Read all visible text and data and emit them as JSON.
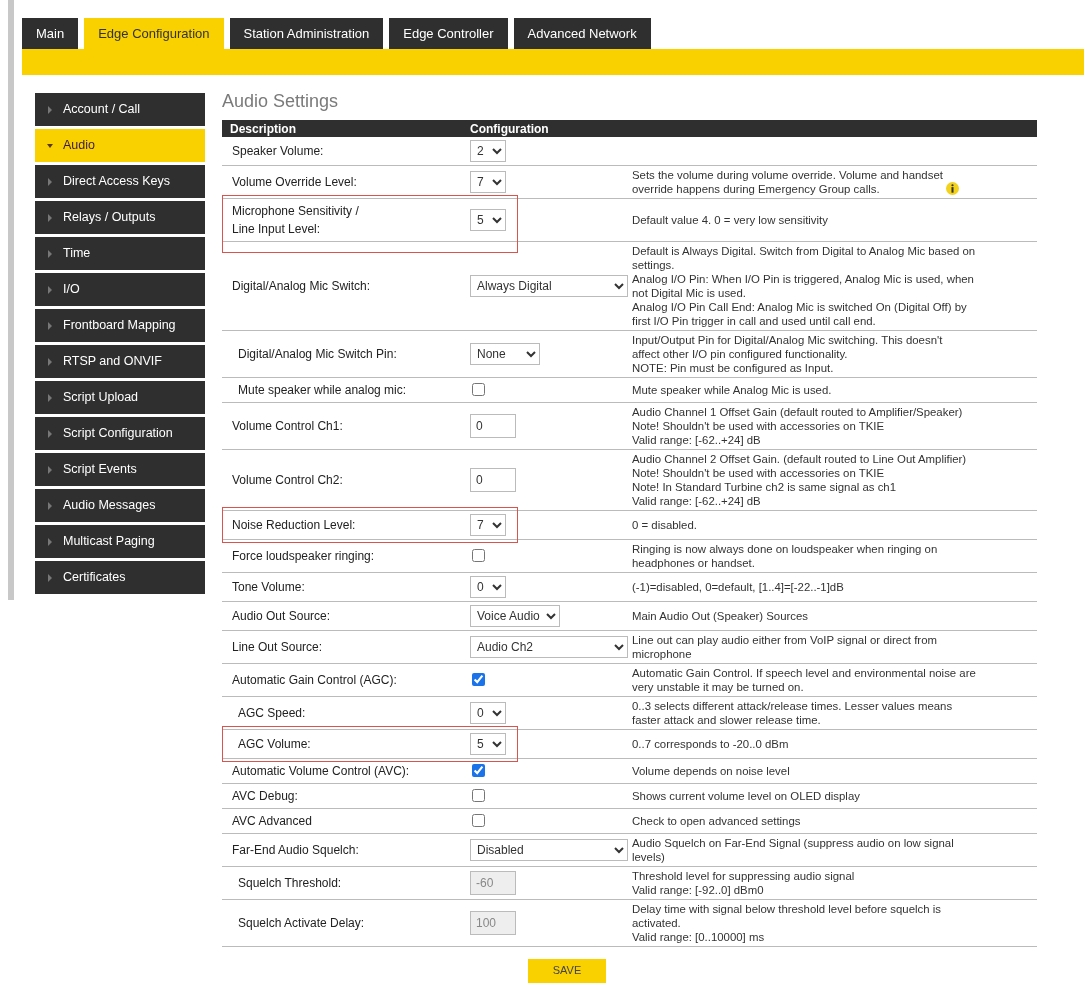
{
  "tabs": [
    {
      "label": "Main",
      "selected": false
    },
    {
      "label": "Edge Configuration",
      "selected": true
    },
    {
      "label": "Station Administration",
      "selected": false
    },
    {
      "label": "Edge Controller",
      "selected": false
    },
    {
      "label": "Advanced Network",
      "selected": false
    }
  ],
  "sidebar": {
    "items": [
      {
        "label": "Account / Call",
        "selected": false
      },
      {
        "label": "Audio",
        "selected": true
      },
      {
        "label": "Direct Access Keys",
        "selected": false
      },
      {
        "label": "Relays / Outputs",
        "selected": false
      },
      {
        "label": "Time",
        "selected": false
      },
      {
        "label": "I/O",
        "selected": false
      },
      {
        "label": "Frontboard Mapping",
        "selected": false
      },
      {
        "label": "RTSP and ONVIF",
        "selected": false
      },
      {
        "label": "Script Upload",
        "selected": false
      },
      {
        "label": "Script Configuration",
        "selected": false
      },
      {
        "label": "Script Events",
        "selected": false
      },
      {
        "label": "Audio Messages",
        "selected": false
      },
      {
        "label": "Multicast Paging",
        "selected": false
      },
      {
        "label": "Certificates",
        "selected": false
      }
    ]
  },
  "page_title": "Audio Settings",
  "table": {
    "columns": [
      "Description",
      "Configuration"
    ],
    "rows": [
      {
        "label": "Speaker Volume:",
        "kind": "level",
        "value": "2",
        "indented": false,
        "highlighted": false
      },
      {
        "label": "Volume Override Level:",
        "kind": "level",
        "value": "7",
        "help": "Sets the volume during volume override. Volume and handset\noverride happens during Emergency Group calls.",
        "info": true,
        "indented": false,
        "highlighted": false
      },
      {
        "label": "Microphone Sensitivity /\nLine Input Level:",
        "kind": "level",
        "value": "5",
        "help": "Default value 4. 0 = very low sensitivity",
        "indented": false,
        "highlighted": true
      },
      {
        "label": "Digital/Analog Mic Switch:",
        "kind": "wideselect",
        "value": "Always Digital",
        "help": "Default is Always Digital. Switch from Digital to Analog Mic based on\nsettings.\nAnalog I/O Pin: When I/O Pin is triggered, Analog Mic is used, when\nnot Digital Mic is used.\nAnalog I/O Pin Call End: Analog Mic is switched On (Digital Off) by\nfirst I/O Pin trigger in call and used until call end.",
        "indented": false,
        "highlighted": false
      },
      {
        "label": "Digital/Analog Mic Switch Pin:",
        "kind": "select",
        "value": "None",
        "help": "Input/Output Pin for Digital/Analog Mic switching. This doesn't\naffect other I/O pin configured functionality.\nNOTE: Pin must be configured as Input.",
        "indented": true,
        "highlighted": false
      },
      {
        "label": "Mute speaker while analog mic:",
        "kind": "checkbox",
        "checked": false,
        "help": "Mute speaker while Analog Mic is used.",
        "indented": true,
        "highlighted": false
      },
      {
        "label": "Volume Control Ch1:",
        "kind": "input",
        "value": "0",
        "disabled": false,
        "help": "Audio Channel 1 Offset Gain (default routed to Amplifier/Speaker)\nNote! Shouldn't be used with accessories on TKIE\nValid range: [-62..+24] dB",
        "indented": false,
        "highlighted": false
      },
      {
        "label": "Volume Control Ch2:",
        "kind": "input",
        "value": "0",
        "disabled": false,
        "help": "Audio Channel 2 Offset Gain. (default routed to Line Out Amplifier)\nNote! Shouldn't be used with accessories on TKIE\nNote! In Standard Turbine ch2 is same signal as ch1\nValid range: [-62..+24] dB",
        "indented": false,
        "highlighted": false
      },
      {
        "label": "Noise Reduction Level:",
        "kind": "level",
        "value": "7",
        "help": "0 = disabled.",
        "indented": false,
        "highlighted": true
      },
      {
        "label": "Force loudspeaker ringing:",
        "kind": "checkbox",
        "checked": false,
        "help": "Ringing is now always done on loudspeaker when ringing on\nheadphones or handset.",
        "indented": false,
        "highlighted": false
      },
      {
        "label": "Tone Volume:",
        "kind": "level",
        "value": "0",
        "help": "(-1)=disabled, 0=default, [1..4]=[-22..-1]dB",
        "indented": false,
        "highlighted": false
      },
      {
        "label": "Audio Out Source:",
        "kind": "select",
        "value": "Voice Audio",
        "help": "Main Audio Out (Speaker) Sources",
        "indented": false,
        "highlighted": false
      },
      {
        "label": "Line Out Source:",
        "kind": "wideselect",
        "value": "Audio Ch2",
        "help": "Line out can play audio either from VoIP signal or direct from\nmicrophone",
        "indented": false,
        "highlighted": false
      },
      {
        "label": "Automatic Gain Control (AGC):",
        "kind": "checkbox",
        "checked": true,
        "help": "Automatic Gain Control. If speech level and environmental noise are\nvery unstable it may be turned on.",
        "indented": false,
        "highlighted": false
      },
      {
        "label": "AGC Speed:",
        "kind": "level",
        "value": "0",
        "help": "0..3 selects different attack/release times. Lesser values means\nfaster attack and slower release time.",
        "indented": true,
        "highlighted": false
      },
      {
        "label": "AGC Volume:",
        "kind": "level",
        "value": "5",
        "help": "0..7 corresponds to -20..0 dBm",
        "indented": true,
        "highlighted": true
      },
      {
        "label": "Automatic Volume Control (AVC):",
        "kind": "checkbox",
        "checked": true,
        "help": "Volume depends on noise level",
        "indented": false,
        "highlighted": false
      },
      {
        "label": "AVC Debug:",
        "kind": "checkbox",
        "checked": false,
        "help": "Shows current volume level on OLED display",
        "indented": false,
        "highlighted": false
      },
      {
        "label": "AVC Advanced",
        "kind": "checkbox",
        "checked": false,
        "help": "Check to open advanced settings",
        "indented": false,
        "highlighted": false
      },
      {
        "label": "Far-End Audio Squelch:",
        "kind": "wideselect",
        "value": "Disabled",
        "help": "Audio Squelch on Far-End Signal (suppress audio on low signal\nlevels)",
        "indented": false,
        "highlighted": false
      },
      {
        "label": "Squelch Threshold:",
        "kind": "input",
        "value": "-60",
        "disabled": true,
        "help": "Threshold level for suppressing audio signal\nValid range: [-92..0] dBm0",
        "indented": true,
        "highlighted": false
      },
      {
        "label": "Squelch Activate Delay:",
        "kind": "input",
        "value": "100",
        "disabled": true,
        "help": "Delay time with signal below threshold level before squelch is\nactivated.\nValid range: [0..10000] ms",
        "indented": true,
        "highlighted": false
      }
    ]
  },
  "save_button": "SAVE"
}
